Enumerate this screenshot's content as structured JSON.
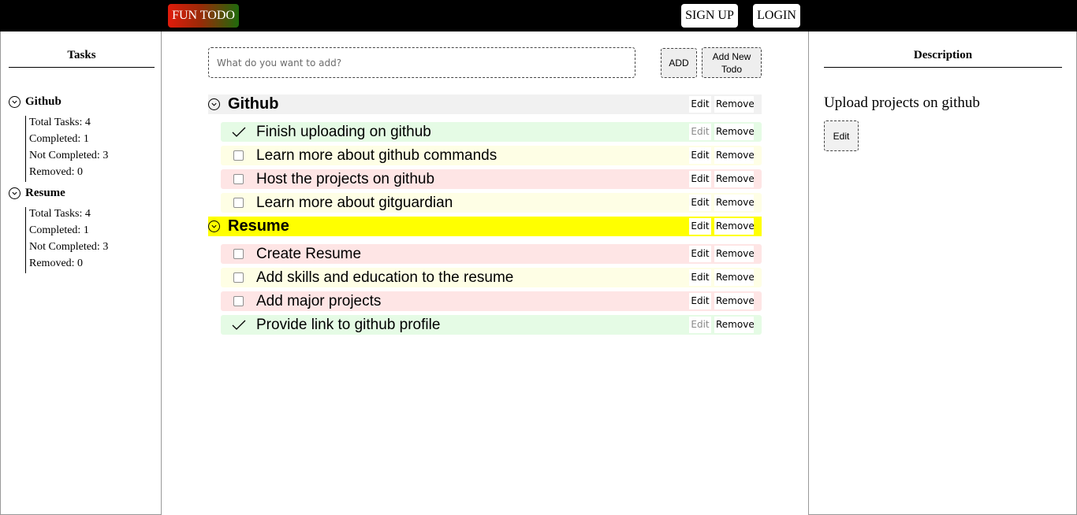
{
  "header": {
    "brand": "FUN TODO",
    "signup_label": "SIGN UP",
    "login_label": "LOGIN"
  },
  "sidebar": {
    "title": "Tasks",
    "groups": [
      {
        "name": "Github",
        "stats": [
          "Total Tasks: 4",
          "Completed: 1",
          "Not Completed: 3",
          "Removed: 0"
        ]
      },
      {
        "name": "Resume",
        "stats": [
          "Total Tasks: 4",
          "Completed: 1",
          "Not Completed: 3",
          "Removed: 0"
        ]
      }
    ]
  },
  "composer": {
    "placeholder": "What do you want to add?",
    "add_label": "ADD",
    "add_new_label_line1": "Add New",
    "add_new_label_line2": "Todo"
  },
  "categories": [
    {
      "name": "Github",
      "edit_label": "Edit",
      "remove_label": "Remove",
      "tasks": [
        {
          "label": "Finish uploading on github",
          "completed": true,
          "edit_label": "Edit",
          "remove_label": "Remove"
        },
        {
          "label": "Learn more about github commands",
          "completed": false,
          "edit_label": "Edit",
          "remove_label": "Remove"
        },
        {
          "label": "Host the projects on github",
          "completed": false,
          "edit_label": "Edit",
          "remove_label": "Remove"
        },
        {
          "label": "Learn more about gitguardian",
          "completed": false,
          "edit_label": "Edit",
          "remove_label": "Remove"
        }
      ]
    },
    {
      "name": "Resume",
      "edit_label": "Edit",
      "remove_label": "Remove",
      "tasks": [
        {
          "label": "Create Resume",
          "completed": false,
          "edit_label": "Edit",
          "remove_label": "Remove"
        },
        {
          "label": "Add skills and education to the resume",
          "completed": false,
          "edit_label": "Edit",
          "remove_label": "Remove"
        },
        {
          "label": "Add major projects",
          "completed": false,
          "edit_label": "Edit",
          "remove_label": "Remove"
        },
        {
          "label": "Provide link to github profile",
          "completed": true,
          "edit_label": "Edit",
          "remove_label": "Remove"
        }
      ]
    }
  ],
  "description": {
    "title": "Description",
    "text": "Upload projects on github",
    "edit_label": "Edit"
  },
  "colors": {
    "completed_row": "#e5fbe5",
    "yellow_row": "#fefee5",
    "red_row": "#fee5e5",
    "selected_category": "#ffff00",
    "category_row": "#f1f1f1"
  }
}
